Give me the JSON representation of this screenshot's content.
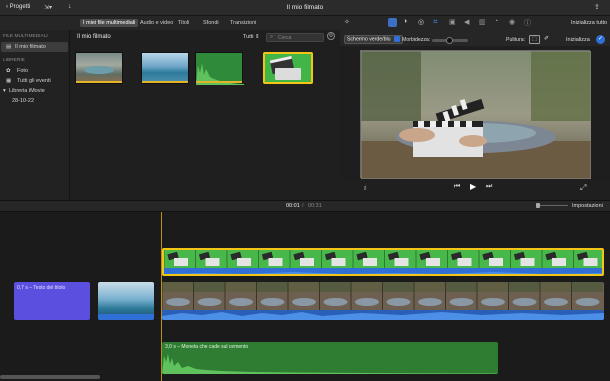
{
  "toolbar": {
    "projects_label": "Progetti",
    "window_title": "Il mio filmato"
  },
  "tabs": [
    {
      "label": "I miei file multimediali",
      "active": true
    },
    {
      "label": "Audio e video",
      "active": false
    },
    {
      "label": "Titoli",
      "active": false
    },
    {
      "label": "Sfondi",
      "active": false
    },
    {
      "label": "Transizioni",
      "active": false
    }
  ],
  "viewer_controls": {
    "reset_all_label": "Inizializza tutto",
    "effect_select": "Schermo verde/blu",
    "softness_label": "Morbidezza:",
    "cleanup_label": "Pulitura:",
    "reset_label": "Inizializza"
  },
  "sidebar": {
    "media_header": "FILE MULTIMEDIALI",
    "selected_item": "Il mio filmato",
    "libraries_header": "LIBRERIE",
    "items": [
      "Foto",
      "Tutti gli eventi"
    ],
    "library_label": "Libreria iMovie",
    "event_label": "28-10-22"
  },
  "browser": {
    "title": "Il mio filmato",
    "filter_label": "Tutti",
    "search_placeholder": "Cerca",
    "thumb_count": 4
  },
  "timeline": {
    "current_time": "00:01",
    "separator": "/",
    "total_time": "00:31",
    "settings_label": "Impostazioni",
    "title_clip_label": "0,7 s – Testo del titolo",
    "audio_clip_label": "3,0 s – Moneta che cade sul cemento"
  },
  "colors": {
    "accent": "#2f6fd6",
    "title_clip": "#5b4fe0",
    "audio_clip": "#3d9a3b",
    "selection": "#f3c514"
  }
}
